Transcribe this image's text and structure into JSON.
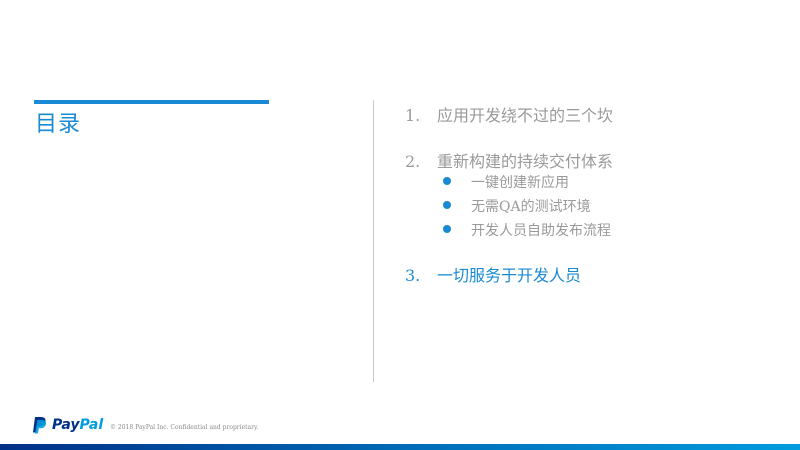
{
  "slide": {
    "title": "目录",
    "accent_color": "#1a8ad4",
    "toc": [
      {
        "num": "1.",
        "label": "应用开发绕不过的三个坎",
        "active": false
      },
      {
        "num": "2.",
        "label": "重新构建的持续交付体系",
        "active": false,
        "subitems": [
          "一键创建新应用",
          "无需QA的测试环境",
          "开发人员自助发布流程"
        ]
      },
      {
        "num": "3.",
        "label": "一切服务于开发人员",
        "active": true
      }
    ]
  },
  "footer": {
    "logo_pay": "Pay",
    "logo_pal": "Pal",
    "logo_icon": "paypal-p-icon",
    "copyright": "© 2018 PayPal Inc. Confidential and proprietary."
  }
}
